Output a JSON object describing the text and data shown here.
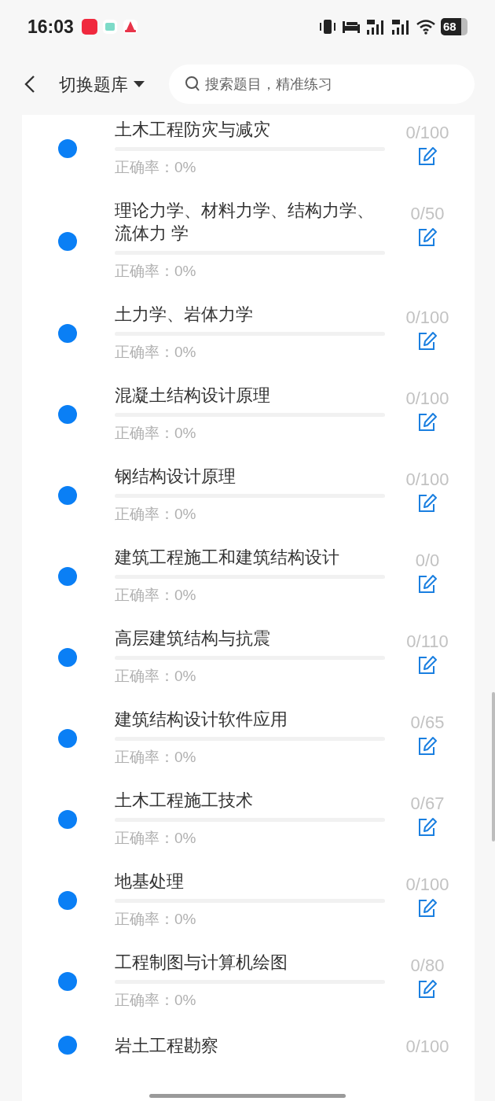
{
  "status_bar": {
    "time": "16:03",
    "battery": "68"
  },
  "header": {
    "title": "切换题库",
    "search": {
      "placeholder": "搜索题目，精准练习"
    }
  },
  "subjects": [
    {
      "title": "土木工程防灾与减灾",
      "level": 0,
      "accuracy": "正确率：0%",
      "count": "0/100"
    },
    {
      "title": "理论力学、材料力学、结构力学、流体力 学",
      "level": 0,
      "accuracy": "正确率：0%",
      "count": "0/50"
    },
    {
      "title": "土力学、岩体力学",
      "level": 0,
      "accuracy": "正确率：0%",
      "count": "0/100"
    },
    {
      "title": "混凝土结构设计原理",
      "level": 0,
      "accuracy": "正确率：0%",
      "count": "0/100"
    },
    {
      "title": "钢结构设计原理",
      "level": 0,
      "accuracy": "正确率：0%",
      "count": "0/100"
    },
    {
      "title": "建筑工程施工和建筑结构设计",
      "level": 0,
      "accuracy": "正确率：0%",
      "count": "0/0"
    },
    {
      "title": "高层建筑结构与抗震",
      "level": 0,
      "accuracy": "正确率：0%",
      "count": "0/110"
    },
    {
      "title": "建筑结构设计软件应用",
      "level": 0,
      "accuracy": "正确率：0%",
      "count": "0/65"
    },
    {
      "title": "土木工程施工技术",
      "level": 0,
      "accuracy": "正确率：0%",
      "count": "0/67"
    },
    {
      "title": "地基处理",
      "level": 0,
      "accuracy": "正确率：0%",
      "count": "0/100"
    },
    {
      "title": "工程制图与计算机绘图",
      "level": 0,
      "accuracy": "正确率：0%",
      "count": "0/80"
    },
    {
      "title": "岩土工程勘察",
      "count": "0/100"
    }
  ]
}
